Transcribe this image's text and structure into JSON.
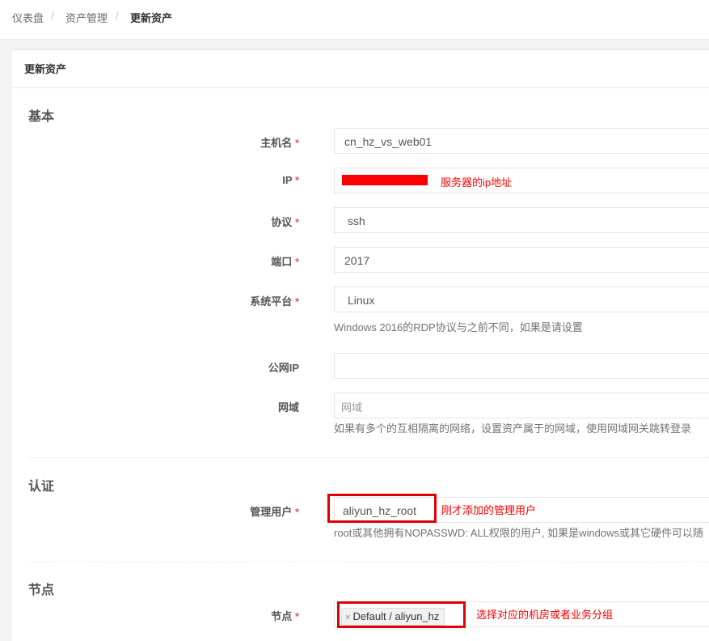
{
  "breadcrumb": {
    "items": [
      "仪表盘",
      "资产管理",
      "更新资产"
    ],
    "separator": "/"
  },
  "panel_title": "更新资产",
  "sections": {
    "basic": "基本",
    "auth": "认证",
    "node": "节点"
  },
  "fields": {
    "hostname": {
      "label": "主机名",
      "value": "cn_hz_vs_web01"
    },
    "ip": {
      "label": "IP",
      "value": "",
      "annotation": "服务器的ip地址"
    },
    "protocol": {
      "label": "协议",
      "value": "ssh"
    },
    "port": {
      "label": "端口",
      "value": "2017"
    },
    "platform": {
      "label": "系统平台",
      "value": "Linux",
      "help": "Windows 2016的RDP协议与之前不同，如果是请设置"
    },
    "public_ip": {
      "label": "公网IP",
      "value": ""
    },
    "domain": {
      "label": "网域",
      "placeholder": "网域",
      "help": "如果有多个的互相隔离的网络，设置资产属于的网域，使用网域网关跳转登录"
    },
    "admin_user": {
      "label": "管理用户",
      "value": "aliyun_hz_root",
      "annotation": "刚才添加的管理用户",
      "help": "root或其他拥有NOPASSWD: ALL权限的用户, 如果是windows或其它硬件可以随"
    },
    "nodes": {
      "label": "节点",
      "tag": "Default / aliyun_hz",
      "tag_remove": "×",
      "annotation": "选择对应的机房或者业务分组"
    }
  },
  "required_mark": "*",
  "colors": {
    "required": "#ed5565",
    "annotation": "#ff0000",
    "redaction": "#ff0000"
  }
}
